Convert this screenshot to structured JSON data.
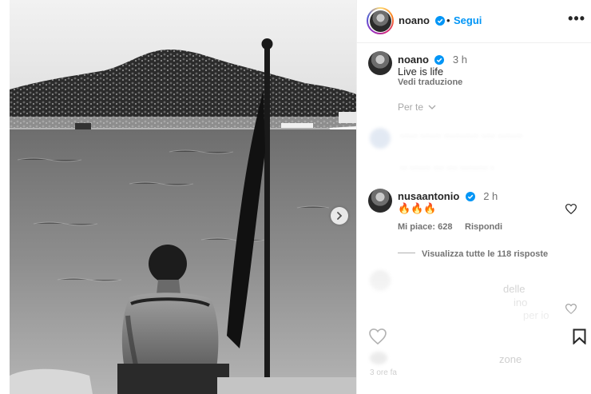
{
  "post": {
    "author": "noano",
    "follow_label": "Segui",
    "separator": "•"
  },
  "caption": {
    "author": "noano",
    "time": "3 h",
    "text": "Live is life",
    "translate_label": "Vedi traduzione",
    "sort_label": "Per te"
  },
  "comments": [
    {
      "author": "nusaantonio",
      "time": "2 h",
      "text": "🔥🔥🔥",
      "likes_label": "Mi piace: 628",
      "reply_label": "Rispondi",
      "view_replies_label": "Visualizza tutte le 118 risposte"
    }
  ],
  "obscured": {
    "line1": "····· ······ ·········· ···· ·······",
    "line2": "·· ······ ··· ··· ········ ·",
    "snippet1": "delle",
    "snippet2": "ino",
    "snippet3": "per io",
    "bottom_snippet": "zone",
    "bottom_time": "3 ore fa"
  },
  "colors": {
    "accent": "#0095f6",
    "verified": "#0095f6",
    "text": "#262626",
    "muted": "#737373"
  },
  "icons": [
    "verified-icon",
    "more-options-icon",
    "heart-icon",
    "bookmark-icon",
    "chevron-right-icon",
    "chevron-down-icon"
  ]
}
